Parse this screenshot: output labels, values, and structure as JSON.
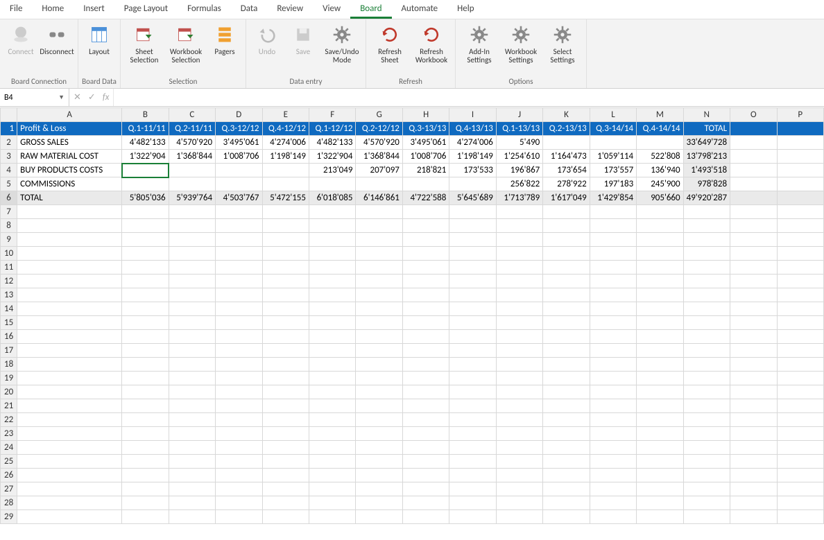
{
  "menu": {
    "items": [
      "File",
      "Home",
      "Insert",
      "Page Layout",
      "Formulas",
      "Data",
      "Review",
      "View",
      "Board",
      "Automate",
      "Help"
    ],
    "active": "Board"
  },
  "ribbon": {
    "groups": [
      {
        "label": "Board Connection",
        "items": [
          {
            "name": "connect-button",
            "label": "Connect",
            "disabled": true
          },
          {
            "name": "disconnect-button",
            "label": "Disconnect"
          }
        ]
      },
      {
        "label": "Board Data",
        "items": [
          {
            "name": "layout-button",
            "label": "Layout"
          }
        ]
      },
      {
        "label": "Selection",
        "items": [
          {
            "name": "sheet-selection-button",
            "label": "Sheet Selection"
          },
          {
            "name": "workbook-selection-button",
            "label": "Workbook Selection"
          },
          {
            "name": "pagers-button",
            "label": "Pagers"
          }
        ]
      },
      {
        "label": "Data entry",
        "items": [
          {
            "name": "undo-button",
            "label": "Undo",
            "disabled": true
          },
          {
            "name": "save-button",
            "label": "Save",
            "disabled": true
          },
          {
            "name": "save-undo-mode-button",
            "label": "Save/Undo Mode"
          }
        ]
      },
      {
        "label": "Refresh",
        "items": [
          {
            "name": "refresh-sheet-button",
            "label": "Refresh Sheet"
          },
          {
            "name": "refresh-workbook-button",
            "label": "Refresh Workbook"
          }
        ]
      },
      {
        "label": "Options",
        "items": [
          {
            "name": "addin-settings-button",
            "label": "Add-In Settings"
          },
          {
            "name": "workbook-settings-button",
            "label": "Workbook Settings"
          },
          {
            "name": "select-settings-button",
            "label": "Select Settings"
          }
        ]
      }
    ]
  },
  "namebox": {
    "value": "B4"
  },
  "formula_bar": {
    "value": ""
  },
  "columns": [
    "A",
    "B",
    "C",
    "D",
    "E",
    "F",
    "G",
    "H",
    "I",
    "J",
    "K",
    "L",
    "M",
    "N",
    "O",
    "P"
  ],
  "header_row": [
    "Profit & Loss",
    "Q.1-11/11",
    "Q.2-11/11",
    "Q.3-12/12",
    "Q.4-12/12",
    "Q.1-12/12",
    "Q.2-12/12",
    "Q.3-13/13",
    "Q.4-13/13",
    "Q.1-13/13",
    "Q.2-13/13",
    "Q.3-14/14",
    "Q.4-14/14",
    "TOTAL"
  ],
  "data_rows": [
    {
      "label": "GROSS SALES",
      "vals": [
        "4'482'133",
        "4'570'920",
        "3'495'061",
        "4'274'006",
        "4'482'133",
        "4'570'920",
        "3'495'061",
        "4'274'006",
        "5'490",
        "",
        "",
        "",
        "33'649'728"
      ]
    },
    {
      "label": "RAW MATERIAL COST",
      "vals": [
        "1'322'904",
        "1'368'844",
        "1'008'706",
        "1'198'149",
        "1'322'904",
        "1'368'844",
        "1'008'706",
        "1'198'149",
        "1'254'610",
        "1'164'473",
        "1'059'114",
        "522'808",
        "13'798'213"
      ]
    },
    {
      "label": "BUY PRODUCTS COSTS",
      "vals": [
        "",
        "",
        "",
        "",
        "213'049",
        "207'097",
        "218'821",
        "173'533",
        "196'867",
        "173'654",
        "173'557",
        "136'940",
        "1'493'518"
      ]
    },
    {
      "label": "COMMISSIONS",
      "vals": [
        "",
        "",
        "",
        "",
        "",
        "",
        "",
        "",
        "256'822",
        "278'922",
        "197'183",
        "245'900",
        "978'828"
      ]
    },
    {
      "label": "TOTAL",
      "vals": [
        "5'805'036",
        "5'939'764",
        "4'503'767",
        "5'472'155",
        "6'018'085",
        "6'146'861",
        "4'722'588",
        "5'645'689",
        "1'713'789",
        "1'617'049",
        "1'429'854",
        "905'660",
        "49'920'287"
      ],
      "isTotal": true
    }
  ],
  "empty_rows_from": 7,
  "empty_rows_to": 29,
  "selected_cell": {
    "row": 4,
    "col": "B"
  }
}
